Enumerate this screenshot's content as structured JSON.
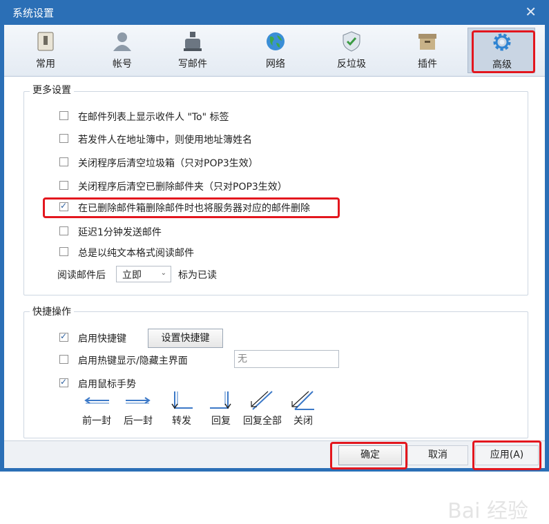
{
  "window": {
    "title": "系统设置"
  },
  "toolbar": {
    "tabs": [
      {
        "label": "常用",
        "icon": "phone-icon"
      },
      {
        "label": "帐号",
        "icon": "user-icon"
      },
      {
        "label": "写邮件",
        "icon": "inkwell-icon"
      },
      {
        "label": "网络",
        "icon": "globe-icon"
      },
      {
        "label": "反垃圾",
        "icon": "shield-icon"
      },
      {
        "label": "插件",
        "icon": "box-icon"
      },
      {
        "label": "高级",
        "icon": "gear-icon",
        "selected": true
      }
    ]
  },
  "more_settings": {
    "title": "更多设置",
    "options": [
      {
        "label": "在邮件列表上显示收件人 \"To\" 标签",
        "checked": false
      },
      {
        "label": "若发件人在地址簿中，则使用地址簿姓名",
        "checked": false
      },
      {
        "label": "关闭程序后清空垃圾箱（只对POP3生效）",
        "checked": false
      },
      {
        "label": "关闭程序后清空已删除邮件夹（只对POP3生效）",
        "checked": false
      },
      {
        "label": "在已删除邮件箱删除邮件时也将服务器对应的邮件删除",
        "checked": true
      },
      {
        "label": "延迟1分钟发送邮件",
        "checked": false
      },
      {
        "label": "总是以纯文本格式阅读邮件",
        "checked": false
      }
    ],
    "after_read_prefix": "阅读邮件后",
    "after_read_value": "立即",
    "after_read_suffix": "标为已读"
  },
  "shortcuts": {
    "title": "快捷操作",
    "enable_hotkeys_label": "启用快捷键",
    "enable_hotkeys_checked": true,
    "set_hotkeys_button": "设置快捷键",
    "show_hide_label": "启用热键显示/隐藏主界面",
    "show_hide_checked": false,
    "show_hide_value": "无",
    "mouse_gesture_label": "启用鼠标手势",
    "mouse_gesture_checked": true,
    "gestures": [
      {
        "label": "前一封",
        "icon": "arrow-left-icon"
      },
      {
        "label": "后一封",
        "icon": "arrow-right-icon"
      },
      {
        "label": "转发",
        "icon": "down-right-gesture-icon"
      },
      {
        "label": "回复",
        "icon": "down-left-gesture-icon"
      },
      {
        "label": "回复全部",
        "icon": "diagonal-down-left-icon"
      },
      {
        "label": "关闭",
        "icon": "diagonal-close-icon"
      }
    ]
  },
  "footer": {
    "ok_button": "确定",
    "cancel_button": "取消",
    "apply_button": "应用(A)"
  },
  "watermark": "Bai 经验",
  "colors": {
    "title_bar": "#2b6fb6",
    "highlight": "#e3161e",
    "gesture": "#3b78c7"
  }
}
